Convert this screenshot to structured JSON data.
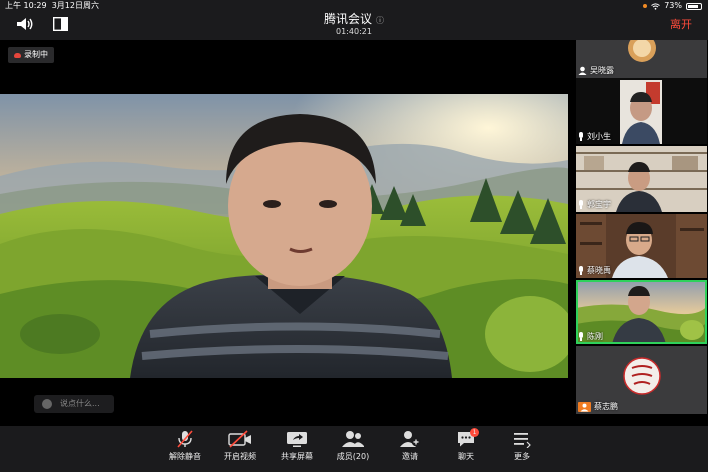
{
  "status_bar": {
    "time": "上午 10:29",
    "date": "3月12日周六",
    "battery": "73%"
  },
  "header": {
    "title": "腾讯会议",
    "timer": "01:40:21",
    "leave_label": "离开"
  },
  "stage": {
    "recording_label": "录制中",
    "chat_placeholder": "说点什么..."
  },
  "participants": [
    {
      "name": "吴晓露",
      "icon": "user-icon"
    },
    {
      "name": "刘小生",
      "icon": "mic-icon"
    },
    {
      "name": "郭宝宇",
      "icon": "mic-icon"
    },
    {
      "name": "蔡晓禹",
      "icon": "mic-icon"
    },
    {
      "name": "陈刚",
      "icon": "mic-icon",
      "active": true
    },
    {
      "name": "蔡志鹏",
      "icon": "user-icon"
    }
  ],
  "toolbar": {
    "mute_label": "解除静音",
    "video_label": "开启视频",
    "share_label": "共享屏幕",
    "members_label": "成员(20)",
    "invite_label": "邀请",
    "chat_label": "聊天",
    "chat_badge": "1",
    "more_label": "更多"
  },
  "colors": {
    "leave": "#ff4b3b",
    "active_speaker": "#2fd15b",
    "bar_bg": "#1b1b1d"
  }
}
